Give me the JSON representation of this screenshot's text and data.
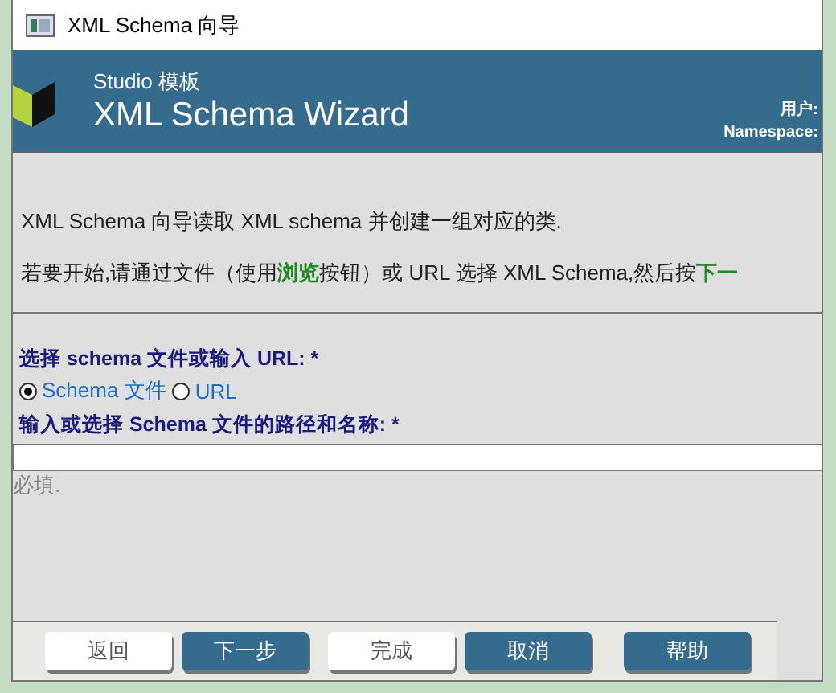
{
  "window": {
    "title": "XML Schema 向导"
  },
  "header": {
    "subtitle": "Studio 模板",
    "title": "XML Schema Wizard",
    "user_label": "用户:",
    "namespace_label": "Namespace:"
  },
  "intro": [
    {
      "parts": [
        {
          "kind": "plain",
          "text": "XML Schema 向导读取 XML schema 并创建一组对应的类."
        }
      ]
    },
    {
      "parts": [
        {
          "kind": "plain",
          "text": "若要开始,请通过文件（使用"
        },
        {
          "kind": "highlight",
          "text": "浏览"
        },
        {
          "kind": "plain",
          "text": "按钮）或 URL 选择 XML Schema,然后按"
        },
        {
          "kind": "highlight",
          "text": "下一"
        }
      ]
    }
  ],
  "source": {
    "label": "选择 schema 文件或输入 URL: *",
    "options": [
      {
        "label": "Schema 文件",
        "selected": true
      },
      {
        "label": "URL",
        "selected": false
      }
    ]
  },
  "path": {
    "label": "输入或选择 Schema 文件的路径和名称: *",
    "hint": "必填."
  },
  "buttons": [
    {
      "label": "返回",
      "disabled": true
    },
    {
      "label": "下一步",
      "disabled": false
    },
    {
      "label": "完成",
      "disabled": true
    },
    {
      "label": "取消",
      "disabled": false
    },
    {
      "label": "帮助",
      "disabled": false
    }
  ]
}
